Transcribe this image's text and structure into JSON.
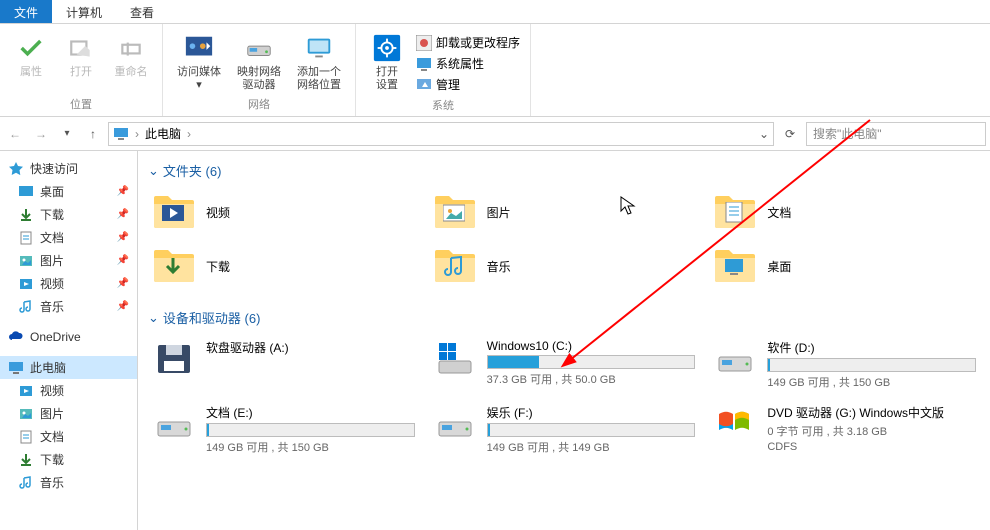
{
  "tabs": {
    "file": "文件",
    "computer": "计算机",
    "view": "查看"
  },
  "ribbon": {
    "groups": {
      "location": {
        "label": "位置",
        "props": "属性",
        "open": "打开",
        "rename": "重命名"
      },
      "network": {
        "label": "网络",
        "media": "访问媒体",
        "mapdrive_l1": "映射网络",
        "mapdrive_l2": "驱动器",
        "addnet_l1": "添加一个",
        "addnet_l2": "网络位置"
      },
      "system": {
        "label": "系统",
        "settings_l1": "打开",
        "settings_l2": "设置",
        "uninstall": "卸载或更改程序",
        "sysprops": "系统属性",
        "manage": "管理"
      }
    }
  },
  "nav": {
    "back": "←",
    "forward": "→",
    "up": "↑"
  },
  "addressbar": {
    "root": "此电脑",
    "sep": "›"
  },
  "search": {
    "placeholder": "搜索\"此电脑\""
  },
  "sidebar": {
    "quick": "快速访问",
    "items1": [
      "桌面",
      "下载",
      "文档",
      "图片",
      "视频",
      "音乐"
    ],
    "onedrive": "OneDrive",
    "thispc": "此电脑",
    "items2": [
      "视频",
      "图片",
      "文档",
      "下载",
      "音乐"
    ]
  },
  "sections": {
    "folders": {
      "title": "文件夹 (6)",
      "items": [
        "视频",
        "图片",
        "文档",
        "下载",
        "音乐",
        "桌面"
      ]
    },
    "drives": {
      "title": "设备和驱动器 (6)",
      "items": [
        {
          "name": "软盘驱动器 (A:)",
          "bar": false,
          "sub": ""
        },
        {
          "name": "Windows10 (C:)",
          "bar": true,
          "fill": 25,
          "sub": "37.3 GB 可用 , 共 50.0 GB"
        },
        {
          "name": "软件 (D:)",
          "bar": true,
          "fill": 1,
          "sub": "149 GB 可用 , 共 150 GB"
        },
        {
          "name": "文档 (E:)",
          "bar": true,
          "fill": 1,
          "sub": "149 GB 可用 , 共 150 GB"
        },
        {
          "name": "娱乐 (F:)",
          "bar": true,
          "fill": 1,
          "sub": "149 GB 可用 , 共 149 GB"
        },
        {
          "name": "DVD 驱动器 (G:) Windows中文版",
          "bar": false,
          "sub": "0 字节 可用 , 共 3.18 GB",
          "sub2": "CDFS"
        }
      ]
    }
  }
}
